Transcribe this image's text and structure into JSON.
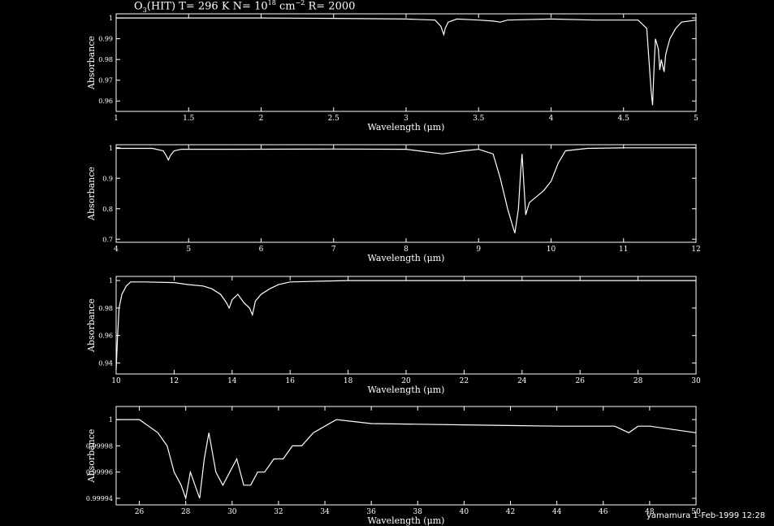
{
  "header": {
    "title_pre": "O",
    "title_sub": "3",
    "title_mid": "(HIT) T= 296 K N= 10",
    "title_sup1": "18",
    "title_unit": " cm",
    "title_sup2": "−2",
    "title_end": " R= 2000"
  },
  "footer": {
    "text": "yamamura  1-Feb-1999 12:28"
  },
  "colors": {
    "background": "#000000",
    "foreground": "#ffffff"
  },
  "chart_data": [
    {
      "type": "line",
      "title": "O3(HIT) T= 296 K N= 10^18 cm^-2 R= 2000",
      "xlabel": "Wavelength (μm)",
      "ylabel": "Absorbance",
      "xlim": [
        1,
        5
      ],
      "ylim": [
        0.955,
        1.002
      ],
      "xticks": [
        1,
        1.5,
        2,
        2.5,
        3,
        3.5,
        4,
        4.5,
        5
      ],
      "xticklabels": [
        "1",
        "1.5",
        "2",
        "2.5",
        "3",
        "3.5",
        "4",
        "4.5",
        "5"
      ],
      "yticks": [
        0.96,
        0.97,
        0.98,
        0.99,
        1
      ],
      "yticklabels": [
        "0.96",
        "0.97",
        "0.98",
        "0.99",
        "1"
      ],
      "series": [
        {
          "x": [
            1,
            2.0,
            2.5,
            3.0,
            3.2,
            3.24,
            3.26,
            3.27,
            3.29,
            3.35,
            3.5,
            3.6,
            3.65,
            3.7,
            4.0,
            4.3,
            4.6,
            4.66,
            4.68,
            4.69,
            4.7,
            4.71,
            4.72,
            4.74,
            4.75,
            4.76,
            4.78,
            4.79,
            4.8,
            4.82,
            4.86,
            4.9,
            5.0
          ],
          "y": [
            1,
            1,
            0.9998,
            0.9995,
            0.999,
            0.996,
            0.992,
            0.995,
            0.998,
            0.9995,
            0.999,
            0.9985,
            0.998,
            0.999,
            0.9995,
            0.999,
            0.999,
            0.995,
            0.975,
            0.965,
            0.958,
            0.975,
            0.99,
            0.985,
            0.975,
            0.98,
            0.974,
            0.982,
            0.985,
            0.99,
            0.995,
            0.998,
            0.999
          ]
        }
      ]
    },
    {
      "type": "line",
      "xlabel": "Wavelength (μm)",
      "ylabel": "Absorbance",
      "xlim": [
        4,
        12
      ],
      "ylim": [
        0.69,
        1.01
      ],
      "xticks": [
        4,
        5,
        6,
        7,
        8,
        9,
        10,
        11,
        12
      ],
      "xticklabels": [
        "4",
        "5",
        "6",
        "7",
        "8",
        "9",
        "10",
        "11",
        "12"
      ],
      "yticks": [
        0.7,
        0.8,
        0.9,
        1
      ],
      "yticklabels": [
        "0.7",
        "0.8",
        "0.9",
        "1"
      ],
      "series": [
        {
          "x": [
            4,
            4.5,
            4.65,
            4.7,
            4.72,
            4.75,
            4.8,
            4.9,
            5.5,
            7.0,
            8.0,
            8.5,
            8.8,
            9.0,
            9.2,
            9.3,
            9.4,
            9.45,
            9.5,
            9.55,
            9.58,
            9.6,
            9.65,
            9.7,
            9.8,
            9.9,
            10.0,
            10.1,
            10.2,
            10.5,
            11.0,
            12.0
          ],
          "y": [
            0.998,
            0.998,
            0.99,
            0.97,
            0.96,
            0.975,
            0.99,
            0.995,
            0.995,
            0.996,
            0.995,
            0.98,
            0.99,
            0.995,
            0.98,
            0.9,
            0.8,
            0.76,
            0.72,
            0.8,
            0.92,
            0.98,
            0.78,
            0.82,
            0.84,
            0.86,
            0.89,
            0.95,
            0.99,
            0.998,
            1.0,
            1.0
          ]
        }
      ]
    },
    {
      "type": "line",
      "xlabel": "Wavelength (μm)",
      "ylabel": "Absorbance",
      "xlim": [
        10,
        30
      ],
      "ylim": [
        0.932,
        1.003
      ],
      "xticks": [
        10,
        12,
        14,
        16,
        18,
        20,
        22,
        24,
        26,
        28,
        30
      ],
      "xticklabels": [
        "10",
        "12",
        "14",
        "16",
        "18",
        "20",
        "22",
        "24",
        "26",
        "28",
        "30"
      ],
      "yticks": [
        0.94,
        0.96,
        0.98,
        1
      ],
      "yticklabels": [
        "0.94",
        "0.96",
        "0.98",
        "1"
      ],
      "series": [
        {
          "x": [
            10,
            10.05,
            10.1,
            10.2,
            10.35,
            10.5,
            11,
            12,
            12.5,
            13,
            13.3,
            13.6,
            13.8,
            13.9,
            14.0,
            14.2,
            14.4,
            14.6,
            14.7,
            14.8,
            15.0,
            15.3,
            15.6,
            16,
            17,
            18,
            20,
            30
          ],
          "y": [
            0.935,
            0.96,
            0.98,
            0.99,
            0.996,
            0.999,
            0.999,
            0.9985,
            0.997,
            0.996,
            0.994,
            0.99,
            0.984,
            0.98,
            0.986,
            0.99,
            0.984,
            0.98,
            0.975,
            0.985,
            0.99,
            0.994,
            0.997,
            0.999,
            0.9995,
            1.0,
            1.0,
            1.0
          ]
        }
      ]
    },
    {
      "type": "line",
      "xlabel": "Wavelength (μm)",
      "ylabel": "Absorbance",
      "xlim": [
        25,
        50
      ],
      "ylim": [
        0.999935,
        1.00001
      ],
      "xticks": [
        26,
        28,
        30,
        32,
        34,
        36,
        38,
        40,
        42,
        44,
        46,
        48,
        50
      ],
      "xticklabels": [
        "26",
        "28",
        "30",
        "32",
        "34",
        "36",
        "38",
        "40",
        "42",
        "44",
        "46",
        "48",
        "50"
      ],
      "yticks": [
        0.99994,
        0.99996,
        0.99998,
        1
      ],
      "yticklabels": [
        "0.99994",
        "0.99996",
        "0.99998",
        "1"
      ],
      "series": [
        {
          "x": [
            25,
            26,
            26.8,
            27.2,
            27.5,
            27.8,
            28.0,
            28.2,
            28.4,
            28.6,
            28.8,
            29.0,
            29.3,
            29.6,
            29.9,
            30.2,
            30.5,
            30.8,
            31.1,
            31.4,
            31.8,
            32.2,
            32.6,
            33.0,
            33.5,
            34.0,
            34.5,
            36,
            40,
            44,
            46.5,
            47.1,
            47.5,
            48,
            50
          ],
          "y": [
            1.0,
            1.0,
            0.99999,
            0.99998,
            0.99996,
            0.99995,
            0.99994,
            0.99996,
            0.99995,
            0.99994,
            0.99997,
            0.99999,
            0.99996,
            0.99995,
            0.99996,
            0.99997,
            0.99995,
            0.99995,
            0.99996,
            0.99996,
            0.99997,
            0.99997,
            0.99998,
            0.99998,
            0.99999,
            0.999995,
            1.0,
            0.999997,
            0.999996,
            0.999995,
            0.999995,
            0.99999,
            0.999995,
            0.999995,
            0.99999
          ]
        }
      ]
    }
  ]
}
